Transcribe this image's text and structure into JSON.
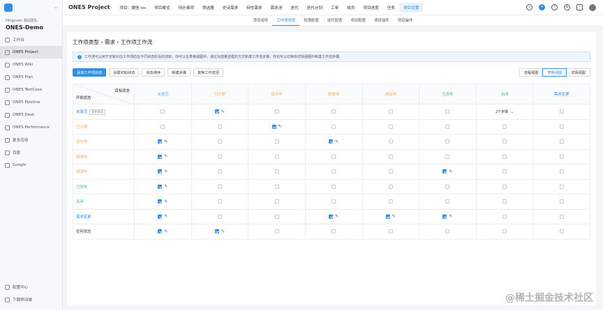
{
  "sidebar": {
    "org": "Hingyuan 测试团队",
    "project": "ONES-Demo",
    "items": [
      "工作台",
      "ONES Project",
      "ONES Wiki",
      "ONES Plan",
      "ONES TestCase",
      "ONES Pipeline",
      "ONES Desk",
      "ONES Performance",
      "更多应用",
      "百度",
      "Google"
    ],
    "bottom": [
      "配置中心",
      "下载移动端"
    ]
  },
  "topbar": {
    "brand": "ONES Project",
    "nav": [
      "项目：微信 ios",
      "项目概览",
      "待办事项",
      "筛选器",
      "史诗需求",
      "特性需求",
      "需求池",
      "迭代",
      "迭代计划",
      "工单",
      "成员",
      "项目进度",
      "任务",
      "项目设置"
    ],
    "active": "项目设置"
  },
  "subnav": {
    "items": [
      "项目组件",
      "工作项类型",
      "权限配置",
      "迭代配置",
      "项目配置",
      "项目插件",
      "项目操作"
    ],
    "active": "工作项类型"
  },
  "breadcrumb": "工作项类型 › 需求 › 工作项工作流",
  "info": "工作流可以用于定制对应工作项的在不同状态阶段的流转，你可以在表格视图中，通过勾选量选框的方式新建工作流步骤，你也可以切换到详情视图中新建工作流步骤。",
  "buttons": [
    "添加工作项状态",
    "设置初始状态",
    "状态排序",
    "新建步骤",
    "复制工作流至"
  ],
  "views": [
    "流程视图",
    "表格视图",
    "详情视图"
  ],
  "table": {
    "target_label": "目标状态",
    "start_label": "开始状态",
    "columns": [
      {
        "name": "未激活",
        "color": "#64b5f6"
      },
      {
        "name": "已计划",
        "color": "#f0a64d"
      },
      {
        "name": "设计中",
        "color": "#f0a64d"
      },
      {
        "name": "研发中",
        "color": "#f0a64d"
      },
      {
        "name": "测试中",
        "color": "#f0a64d"
      },
      {
        "name": "已发布",
        "color": "#3bbf85"
      },
      {
        "name": "关闭",
        "color": "#3bbf85"
      },
      {
        "name": "需求变更",
        "color": "#338fe5"
      }
    ],
    "rows": [
      {
        "name": "未激活",
        "color": "#338fe5",
        "tag": "初始状态",
        "cells": [
          0,
          1,
          0,
          0,
          0,
          0,
          "2个步骤",
          0
        ]
      },
      {
        "name": "已计划",
        "color": "#f0a64d",
        "cells": [
          0,
          0,
          1,
          0,
          0,
          0,
          0,
          0
        ]
      },
      {
        "name": "设计中",
        "color": "#f0a64d",
        "cells": [
          1,
          0,
          0,
          1,
          0,
          0,
          0,
          0
        ]
      },
      {
        "name": "研发中",
        "color": "#f0a64d",
        "cells": [
          1,
          0,
          0,
          0,
          0,
          0,
          0,
          0
        ]
      },
      {
        "name": "测试中",
        "color": "#f0a64d",
        "cells": [
          1,
          0,
          0,
          0,
          0,
          1,
          0,
          0
        ]
      },
      {
        "name": "已发布",
        "color": "#3bbf85",
        "cells": [
          1,
          0,
          0,
          0,
          0,
          0,
          0,
          0
        ]
      },
      {
        "name": "关闭",
        "color": "#3bbf85",
        "cells": [
          1,
          0,
          0,
          0,
          0,
          0,
          0,
          0
        ]
      },
      {
        "name": "需求变更",
        "color": "#338fe5",
        "cells": [
          1,
          0,
          0,
          1,
          1,
          1,
          0,
          0
        ]
      },
      {
        "name": "任何状态",
        "color": "#333333",
        "cells": [
          1,
          1,
          0,
          0,
          0,
          0,
          0,
          0
        ]
      }
    ]
  },
  "watermark": "@稀土掘金技术社区"
}
